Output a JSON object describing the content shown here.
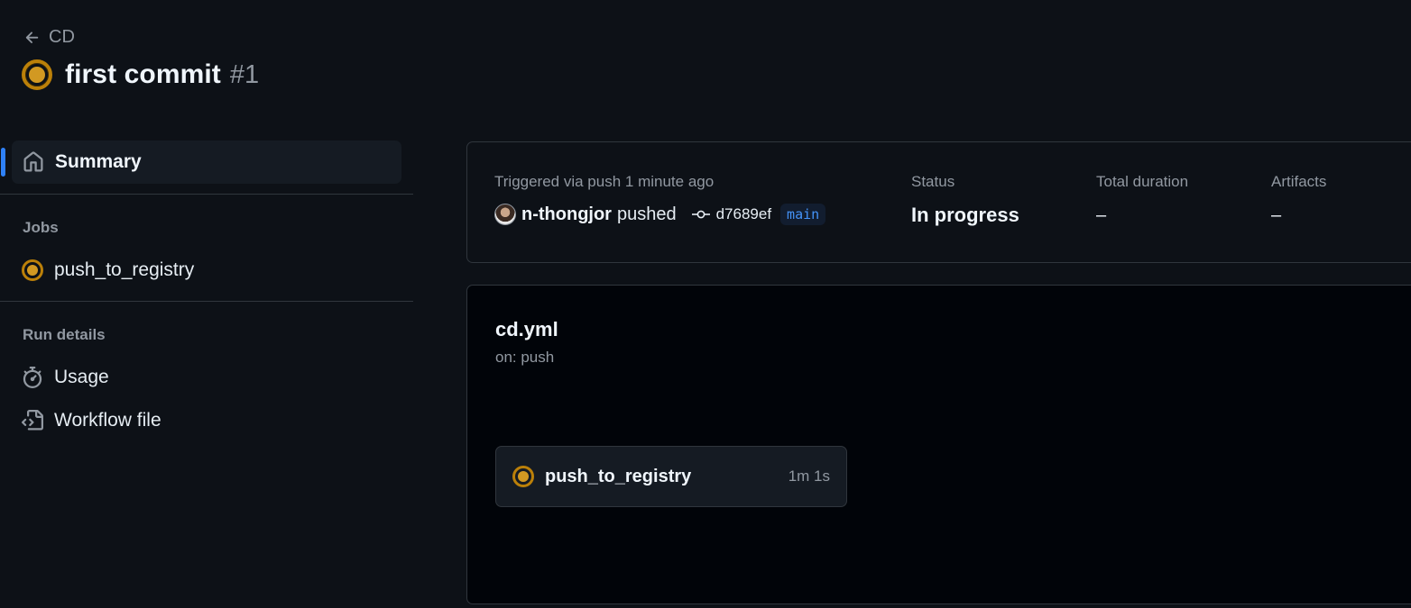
{
  "header": {
    "back_label": "CD",
    "title": "first commit",
    "run_number": "#1"
  },
  "sidebar": {
    "summary_label": "Summary",
    "jobs_heading": "Jobs",
    "jobs": [
      {
        "label": "push_to_registry",
        "status": "in_progress"
      }
    ],
    "run_details_heading": "Run details",
    "run_details": [
      {
        "label": "Usage",
        "icon": "stopwatch-icon"
      },
      {
        "label": "Workflow file",
        "icon": "file-code-icon"
      }
    ]
  },
  "summary": {
    "trigger_text": "Triggered via push 1 minute ago",
    "actor": "n-thongjor",
    "action": "pushed",
    "commit_sha": "d7689ef",
    "branch": "main",
    "status_label": "Status",
    "status_value": "In progress",
    "duration_label": "Total duration",
    "duration_value": "–",
    "artifacts_label": "Artifacts",
    "artifacts_value": "–"
  },
  "graph": {
    "workflow_file": "cd.yml",
    "trigger": "on: push",
    "job": {
      "name": "push_to_registry",
      "elapsed": "1m 1s"
    }
  },
  "colors": {
    "background": "#0d1117",
    "in_progress": "#d29922",
    "accent": "#2f81f7",
    "border": "#30363d"
  }
}
